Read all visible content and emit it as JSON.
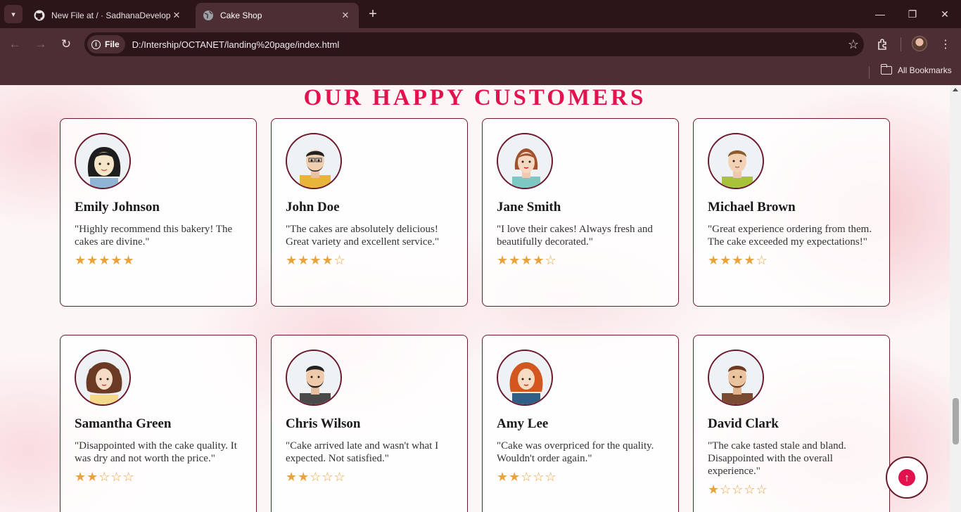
{
  "browser": {
    "tabs": [
      {
        "title": "New File at / · SadhanaDevelop",
        "icon": "github-icon",
        "active": false
      },
      {
        "title": "Cake Shop",
        "icon": "globe-icon",
        "active": true
      }
    ],
    "address": {
      "chip_label": "File",
      "url": "D:/Intership/OCTANET/landing%20page/index.html"
    },
    "bookmarks": {
      "all_label": "All Bookmarks"
    }
  },
  "page": {
    "section_title": "OUR HAPPY CUSTOMERS",
    "accent_color": "#e3124e",
    "border_color": "#6b1a2d",
    "star_color": "#e7a33d",
    "testimonials": [
      {
        "name": "Emily Johnson",
        "quote": "\"Highly recommend this bakery! The cakes are divine.\"",
        "stars": "★★★★★",
        "rating": 5
      },
      {
        "name": "John Doe",
        "quote": "\"The cakes are absolutely delicious! Great variety and excellent service.\"",
        "stars": "★★★★☆",
        "rating": 4
      },
      {
        "name": "Jane Smith",
        "quote": "\"I love their cakes! Always fresh and beautifully decorated.\"",
        "stars": "★★★★☆",
        "rating": 4
      },
      {
        "name": "Michael Brown",
        "quote": "\"Great experience ordering from them. The cake exceeded my expectations!\"",
        "stars": "★★★★☆",
        "rating": 4
      },
      {
        "name": "Samantha Green",
        "quote": "\"Disappointed with the cake quality. It was dry and not worth the price.\"",
        "stars": "★★☆☆☆",
        "rating": 2
      },
      {
        "name": "Chris Wilson",
        "quote": "\"Cake arrived late and wasn't what I expected. Not satisfied.\"",
        "stars": "★★☆☆☆",
        "rating": 2
      },
      {
        "name": "Amy Lee",
        "quote": "\"Cake was overpriced for the quality. Wouldn't order again.\"",
        "stars": "★★☆☆☆",
        "rating": 2
      },
      {
        "name": "David Clark",
        "quote": "\"The cake tasted stale and bland. Disappointed with the overall experience.\"",
        "stars": "★☆☆☆☆",
        "rating": 1
      }
    ],
    "scroll_top_icon": "arrow-up-icon"
  }
}
